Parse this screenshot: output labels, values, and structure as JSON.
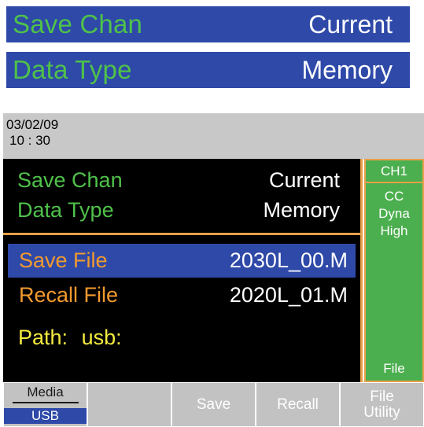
{
  "banner": {
    "save_chan_label": "Save Chan",
    "save_chan_value": "Current",
    "data_type_label": "Data Type",
    "data_type_value": "Memory"
  },
  "screen": {
    "date": "03/02/09",
    "time": "10 : 30",
    "save_chan_label": "Save Chan",
    "save_chan_value": "Current",
    "data_type_label": "Data Type",
    "data_type_value": "Memory",
    "save_file_label": "Save File",
    "save_file_value": "2030L_00.M",
    "recall_file_label": "Recall File",
    "recall_file_value": "2020L_01.M",
    "path_label": "Path:",
    "path_value": "usb:"
  },
  "side": {
    "channel": "CH1",
    "mode": "CC",
    "dyna": "Dyna",
    "range": "High",
    "file": "File"
  },
  "softkeys": {
    "media_top": "Media",
    "media_bottom": "USB",
    "blank": "",
    "save": "Save",
    "recall": "Recall",
    "file_line1": "File",
    "file_line2": "Utility"
  },
  "colors": {
    "banner_blue": "#2e49a8",
    "label_green": "#4fc24a",
    "file_orange": "#f39a2e",
    "path_yellow": "#f3ea3e",
    "side_green": "#4caf4f",
    "accent_border": "#e8a04a"
  }
}
